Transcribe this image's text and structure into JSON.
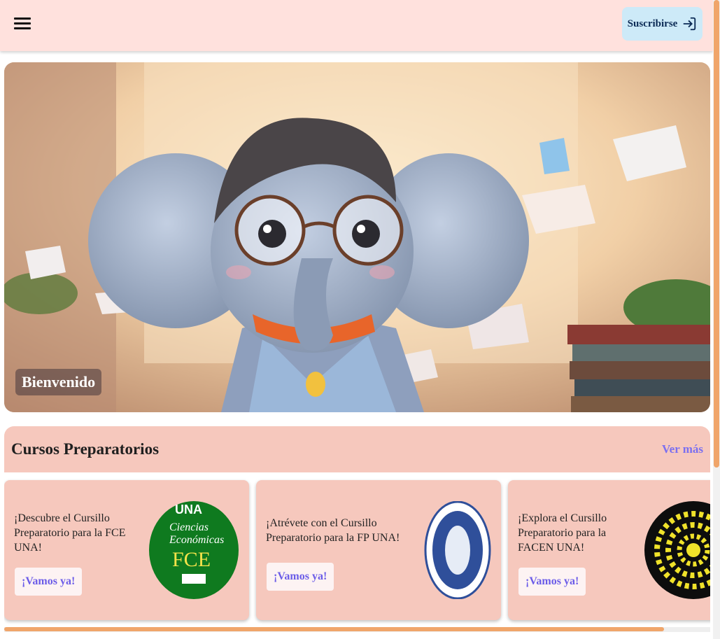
{
  "header": {
    "subscribe_label": "Suscribirse",
    "menu_icon": "hamburger-menu-icon",
    "subscribe_icon": "login-arrow-icon"
  },
  "hero": {
    "caption": "Bienvenido",
    "image": "cartoon elephant with glasses"
  },
  "courses": {
    "title": "Cursos Preparatorios",
    "see_more": "Ver más",
    "cards": [
      {
        "text": "¡Descubre el Cursillo Preparatorio para la FCE UNA!",
        "button": "¡Vamos ya!",
        "logo": "fce-una-logo"
      },
      {
        "text": "¡Atrévete con el Cursillo Preparatorio para la FP UNA!",
        "button": "¡Vamos ya!",
        "logo": "fp-una-seal"
      },
      {
        "text": "¡Explora el Cursillo Preparatorio para la FACEN UNA!",
        "button": "¡Vamos ya!",
        "logo": "facen-una-logo"
      }
    ],
    "fce_logo_text": {
      "top": "UNA",
      "mid1": "Ciencias",
      "mid2": "Económicas",
      "big": "FCE"
    }
  },
  "colors": {
    "header_bg": "#ffe1dd",
    "subscribe_bg": "#cdeaf8",
    "section_bg": "#f6c8bd",
    "accent": "#7b6ff0",
    "scroll": "#f0a56a"
  }
}
